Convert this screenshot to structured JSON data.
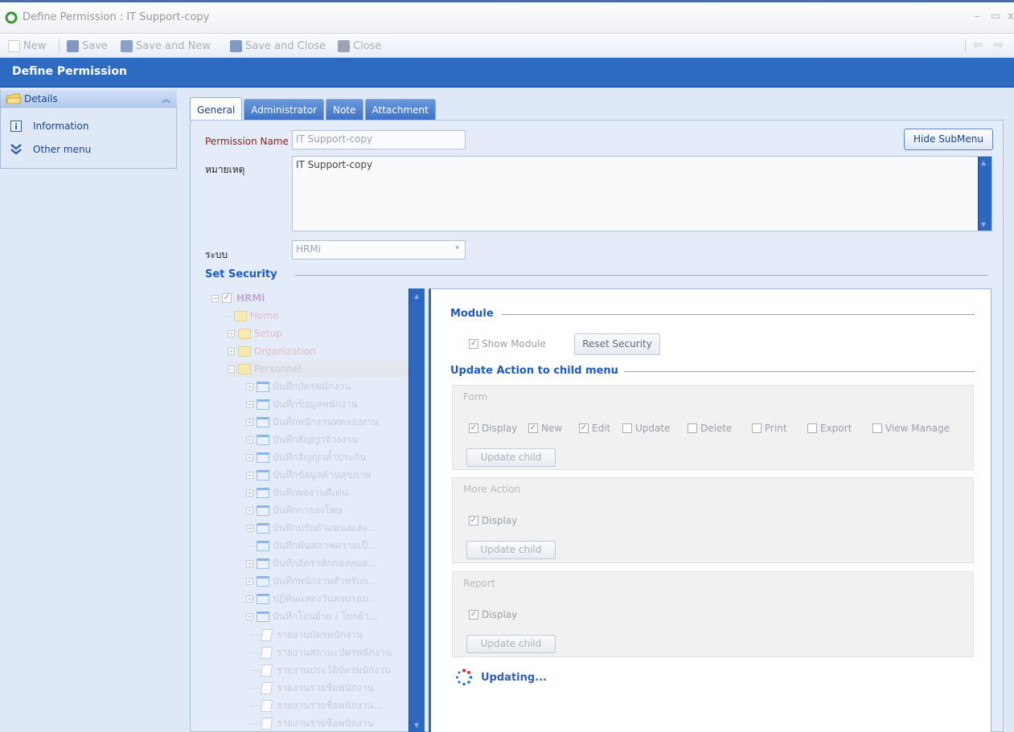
{
  "window": {
    "title": "Define Permission : IT Support-copy",
    "minimize": "–",
    "maximize": "▭",
    "close": "x"
  },
  "toolbar": {
    "new": "New",
    "save": "Save",
    "save_and_new": "Save and New",
    "save_and_close": "Save and Close",
    "close": "Close"
  },
  "page": {
    "title": "Define Permission"
  },
  "sidebar": {
    "header": "Details",
    "items": [
      {
        "label": "Information",
        "icon": "info-icon"
      },
      {
        "label": "Other menu",
        "icon": "double-chevron-down-icon"
      }
    ]
  },
  "tabs": [
    "General",
    "Administrator",
    "Note",
    "Attachment"
  ],
  "form": {
    "permission_name_label": "Permission Name",
    "permission_name_value": "IT Support-copy",
    "remark_label": "หมายเหตุ",
    "remark_value": "IT Support-copy",
    "system_label": "ระบบ",
    "system_value": "HRMi",
    "hide_submenu": "Hide SubMenu",
    "set_security": "Set Security"
  },
  "tree": {
    "root": "HRMi",
    "top": [
      "Home",
      "Setup",
      "Organization",
      "Personnel"
    ],
    "forms": [
      "บันทึกบัตรพนักงาน",
      "บันทึกข้อมูลพนักงาน",
      "บันทึกพนักงานทดลองงาน",
      "บันทึกสัญญาจ้างงาน",
      "บันทึกสัญญาค้ำประกัน",
      "บันทึกข้อมูลด้านสุขภาพ",
      "บันทึกผลงานดีเด่น",
      "บันทึกการลงโทษ",
      "บันทึกปรับตำแหน่งและ...",
      "บันทึกพ้นสภาพความเป็...",
      "บันทึกอัตราหักกองทุนส...",
      "บันทึกพนักงานสำหรับก...",
      "ปฏิทินแสดงวันครบรอบ...",
      "บันทึกโอนย้าย / โยกย้า..."
    ],
    "reports": [
      "รายงานบัตรพนักงาน",
      "รายงานสถานะบัตรพนักงาน",
      "รายงานประวัติบัตรพนักงาน",
      "รายงานรายชื่อพนักงาน",
      "รายงานรายชื่อพนักงาน...",
      "รายงานรายชื่อพนักงาน"
    ]
  },
  "module": {
    "title": "Module",
    "show_module": "Show Module",
    "reset_security": "Reset Security",
    "update_action_title": "Update Action to child menu"
  },
  "groups": {
    "form": {
      "label": "Form",
      "checks": [
        {
          "label": "Display",
          "checked": true
        },
        {
          "label": "New",
          "checked": true
        },
        {
          "label": "Edit",
          "checked": true
        },
        {
          "label": "Update",
          "checked": false
        },
        {
          "label": "Delete",
          "checked": false
        },
        {
          "label": "Print",
          "checked": false
        },
        {
          "label": "Export",
          "checked": false
        },
        {
          "label": "View Manage",
          "checked": false
        }
      ],
      "update_child": "Update child"
    },
    "more_action": {
      "label": "More Action",
      "display": "Display",
      "update_child": "Update child"
    },
    "report": {
      "label": "Report",
      "display": "Display",
      "update_child": "Update child"
    }
  },
  "status": {
    "updating": "Updating..."
  }
}
